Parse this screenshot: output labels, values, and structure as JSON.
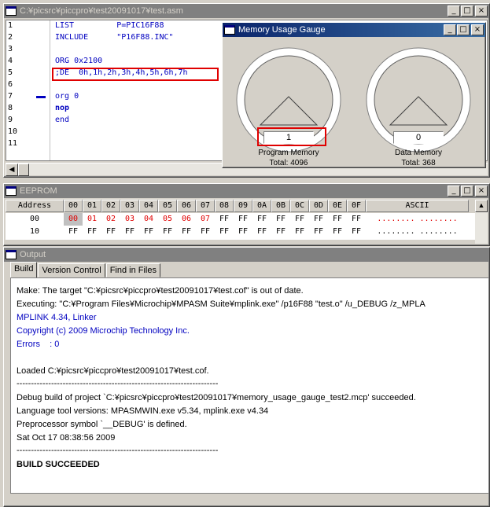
{
  "editor": {
    "title": "C:¥picsrc¥piccpro¥test20091017¥test.asm",
    "line_numbers": [
      "1",
      "2",
      "3",
      "4",
      "5",
      "6",
      "7",
      "8",
      "9",
      "10",
      "11"
    ],
    "lines": [
      {
        "text": "LIST         P=PIC16F88"
      },
      {
        "text": "INCLUDE      \"P16F88.INC\""
      },
      {
        "text": ""
      },
      {
        "text": "ORG 0x2100"
      },
      {
        "text": ";DE  0h,1h,2h,3h,4h,5h,6h,7h"
      },
      {
        "text": ""
      },
      {
        "text": "org 0"
      },
      {
        "text": "nop"
      },
      {
        "text": "end"
      },
      {
        "text": ""
      },
      {
        "text": ""
      }
    ]
  },
  "gauge": {
    "title": "Memory Usage Gauge",
    "program": {
      "value": "1",
      "label": "Program Memory",
      "total": "Total: 4096",
      "fraction": 0.0
    },
    "data": {
      "value": "0",
      "label": "Data Memory",
      "total": "Total: 368",
      "fraction": 0.0
    }
  },
  "eeprom": {
    "title": "EEPROM",
    "headers": [
      "Address",
      "00",
      "01",
      "02",
      "03",
      "04",
      "05",
      "06",
      "07",
      "08",
      "09",
      "0A",
      "0B",
      "0C",
      "0D",
      "0E",
      "0F",
      "ASCII"
    ],
    "rows": [
      {
        "addr": "00",
        "cells": [
          "00",
          "01",
          "02",
          "03",
          "04",
          "05",
          "06",
          "07",
          "FF",
          "FF",
          "FF",
          "FF",
          "FF",
          "FF",
          "FF",
          "FF"
        ],
        "ascii": "........ ........"
      },
      {
        "addr": "10",
        "cells": [
          "FF",
          "FF",
          "FF",
          "FF",
          "FF",
          "FF",
          "FF",
          "FF",
          "FF",
          "FF",
          "FF",
          "FF",
          "FF",
          "FF",
          "FF",
          "FF"
        ],
        "ascii": "........ ........"
      }
    ]
  },
  "output": {
    "title": "Output",
    "tabs": [
      "Build",
      "Version Control",
      "Find in Files"
    ],
    "lines": [
      "Make: The target \"C:¥picsrc¥piccpro¥test20091017¥test.cof\" is out of date.",
      "Executing: \"C:¥Program Files¥Microchip¥MPASM Suite¥mplink.exe\" /p16F88 \"test.o\" /u_DEBUG /z_MPLA",
      "MPLINK 4.34, Linker",
      "Copyright (c) 2009 Microchip Technology Inc.",
      "Errors    : 0",
      "",
      "Loaded C:¥picsrc¥piccpro¥test20091017¥test.cof.",
      "----------------------------------------------------------------------",
      "Debug build of project `C:¥picsrc¥piccpro¥test20091017¥memory_usage_gauge_test2.mcp' succeeded.",
      "Language tool versions: MPASMWIN.exe v5.34, mplink.exe v4.34",
      "Preprocessor symbol `__DEBUG' is defined.",
      "Sat Oct 17 08:38:56 2009",
      "----------------------------------------------------------------------",
      "BUILD SUCCEEDED"
    ]
  },
  "window_buttons": {
    "minimize": "_",
    "maximize": "□",
    "close": "×"
  },
  "colors": {
    "highlight": "#e00000",
    "code_blue": "#0000c0",
    "title_inactive": "#808080"
  }
}
